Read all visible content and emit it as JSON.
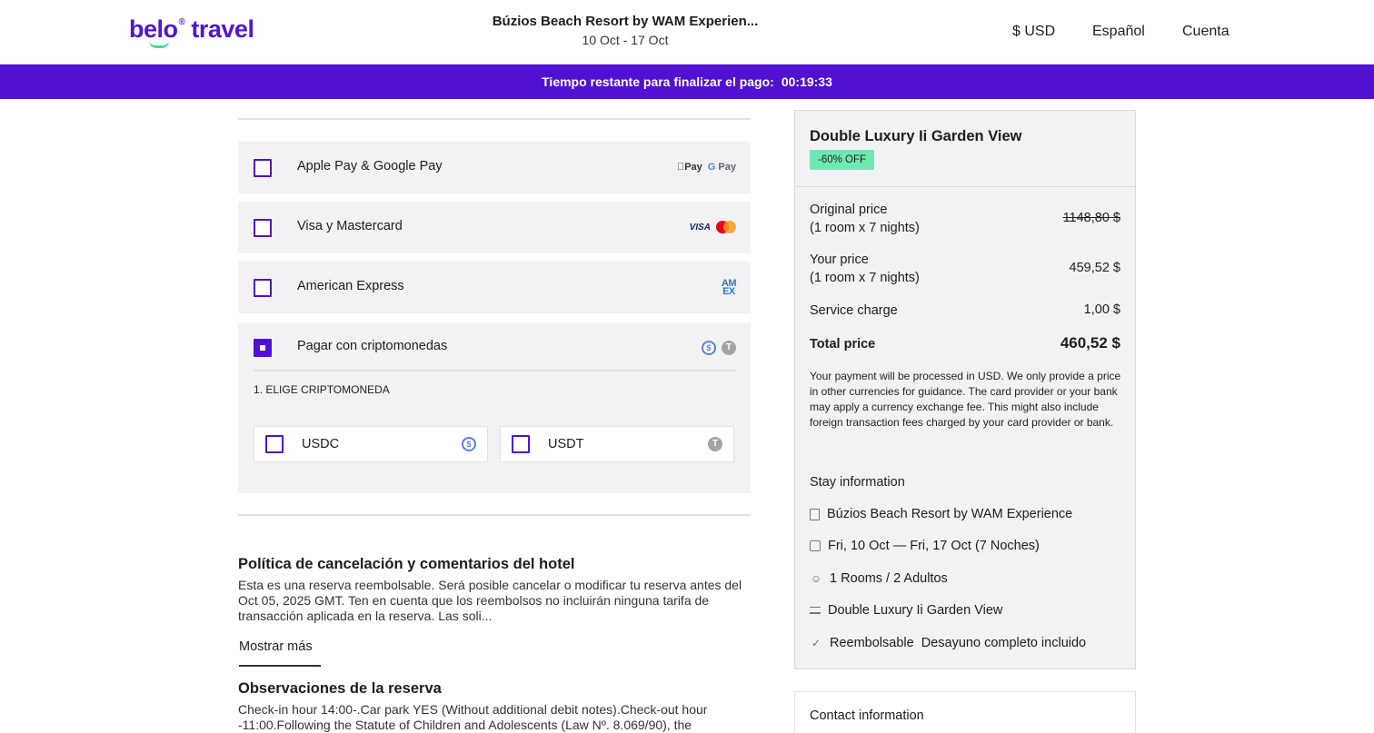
{
  "header": {
    "logo_word1": "belo",
    "logo_reg": "®",
    "logo_word2": "travel",
    "hotel_title": "Búzios Beach Resort by WAM Experien...",
    "dates": "10 Oct - 17 Oct",
    "currency": "$ USD",
    "language": "Español",
    "account": "Cuenta"
  },
  "timer": {
    "label": "Tiempo restante para finalizar el pago:",
    "time": "00:19:33"
  },
  "payment_options": [
    {
      "label": "Apple Pay & Google Pay",
      "checked": false,
      "icons": [
        "apple-pay-icon",
        "google-pay-icon"
      ],
      "icon_text1": "Pay",
      "icon_text2": "Pay"
    },
    {
      "label": "Visa y Mastercard",
      "checked": false,
      "icons": [
        "visa-icon",
        "mastercard-icon"
      ],
      "icon_text1": "VISA"
    },
    {
      "label": "American Express",
      "checked": false,
      "icons": [
        "amex-icon"
      ],
      "icon_text1": "AM",
      "icon_text2": "EX"
    },
    {
      "label": "Pagar con criptomonedas",
      "checked": true,
      "icons": [
        "usdc-icon",
        "usdt-icon"
      ]
    }
  ],
  "crypto": {
    "step_label": "1. ELIGE CRIPTOMONEDA",
    "options": [
      {
        "label": "USDC",
        "icon": "usdc-icon",
        "glyph": "$"
      },
      {
        "label": "USDT",
        "icon": "usdt-icon",
        "glyph": "T"
      }
    ]
  },
  "policy": {
    "title": "Política de cancelación y comentarios del hotel",
    "text": "Esta es una reserva reembolsable. Será posible cancelar o modificar tu reserva antes del Oct 05, 2025 GMT. Ten en cuenta que los reembolsos no incluirán ninguna tarifa de transacción aplicada en la reserva. Las soli...",
    "show_more": "Mostrar más"
  },
  "observations": {
    "title": "Observaciones de la reserva",
    "text": "Check-in hour 14:00-.Car park YES (Without additional debit notes).Check-out hour -11:00.Following the Statute of Children and Adolescents (Law Nº. 8.069/90), the"
  },
  "summary": {
    "room_title": "Double Luxury Ii Garden View",
    "discount": "-60% OFF",
    "original_label": "Original price",
    "original_sub": "(1 room x 7 nights)",
    "original_value": "1148,80 $",
    "your_label": "Your price",
    "your_sub": "(1 room x 7 nights)",
    "your_value": "459,52 $",
    "service_label": "Service charge",
    "service_value": "1,00 $",
    "total_label": "Total price",
    "total_value": "460,52 $",
    "note": "Your payment will be processed in USD. We only provide a price in other currencies for guidance. The card provider or your bank may apply a currency exchange fee. This might also include foreign transaction fees charged by your card provider or bank.",
    "stay_title": "Stay information",
    "stay_items": [
      {
        "icon": "building-icon",
        "text": "Búzios Beach Resort by WAM Experience"
      },
      {
        "icon": "calendar-icon",
        "text": "Fri, 10 Oct — Fri, 17 Oct (7 Noches)"
      },
      {
        "icon": "people-icon",
        "text": "1 Rooms / 2 Adultos"
      },
      {
        "icon": "bed-icon",
        "text": "Double Luxury Ii Garden View"
      },
      {
        "icon": "check-icon",
        "text": "Reembolsable  Desayuno completo incluido"
      }
    ]
  },
  "contact": {
    "title": "Contact information"
  },
  "colors": {
    "brand": "#5011d2",
    "discount": "#6fe8b2",
    "panel": "#f2f2f5"
  }
}
